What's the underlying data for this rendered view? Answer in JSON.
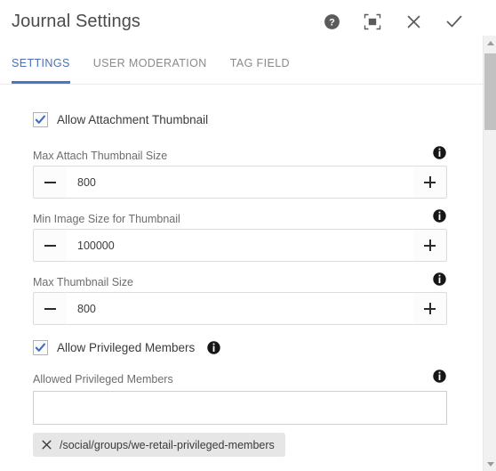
{
  "header": {
    "title": "Journal Settings",
    "actions": [
      {
        "name": "help-icon",
        "label": "Help"
      },
      {
        "name": "fullscreen-icon",
        "label": "Fullscreen"
      },
      {
        "name": "close-icon",
        "label": "Close"
      },
      {
        "name": "check-icon",
        "label": "Done"
      }
    ]
  },
  "tabs": [
    {
      "label": "SETTINGS",
      "active": true
    },
    {
      "label": "USER MODERATION",
      "active": false
    },
    {
      "label": "TAG FIELD",
      "active": false
    }
  ],
  "form": {
    "allow_attachment_thumbnail": {
      "label": "Allow Attachment Thumbnail",
      "checked": true
    },
    "max_attach_thumbnail_size": {
      "label": "Max Attach Thumbnail Size",
      "value": "800",
      "minus": "−",
      "plus": "+"
    },
    "min_image_size_for_thumbnail": {
      "label": "Min Image Size for Thumbnail",
      "value": "100000",
      "minus": "−",
      "plus": "+"
    },
    "max_thumbnail_size": {
      "label": "Max Thumbnail Size",
      "value": "800",
      "minus": "−",
      "plus": "+"
    },
    "allow_privileged_members": {
      "label": "Allow Privileged Members",
      "checked": true
    },
    "allowed_privileged_members": {
      "label": "Allowed Privileged Members",
      "value": "",
      "placeholder": "",
      "chips": [
        {
          "text": "/social/groups/we-retail-privileged-members"
        }
      ]
    }
  },
  "colors": {
    "accent": "#4a74c4",
    "checkmark": "#3a6fc4",
    "info_icon": "#161616",
    "chip_bg": "#e6e6e6",
    "text": "#4b4b4b"
  }
}
